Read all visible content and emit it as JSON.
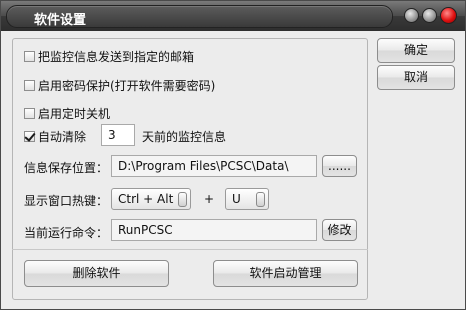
{
  "window": {
    "title": "软件设置"
  },
  "options": {
    "send_email": {
      "label": "把监控信息发送到指定的邮箱",
      "checked": false
    },
    "password": {
      "label": "启用密码保护(打开软件需要密码)",
      "checked": false
    },
    "shutdown": {
      "label": "启用定时关机",
      "checked": false
    },
    "auto_clear": {
      "label": "自动清除",
      "checked": true,
      "days": "3",
      "suffix": "天前的监控信息"
    }
  },
  "save_location": {
    "label": "信息保存位置：",
    "value": "D:\\Program Files\\PCSC\\Data\\",
    "browse": "......"
  },
  "hotkey": {
    "label": "显示窗口热键：",
    "modifier": "Ctrl + Alt",
    "plus": "+",
    "key": "U"
  },
  "run_command": {
    "label": "当前运行命令：",
    "value": "RunPCSC",
    "edit": "修改"
  },
  "buttons": {
    "delete": "删除软件",
    "startup": "软件启动管理",
    "ok": "确定",
    "cancel": "取消"
  }
}
